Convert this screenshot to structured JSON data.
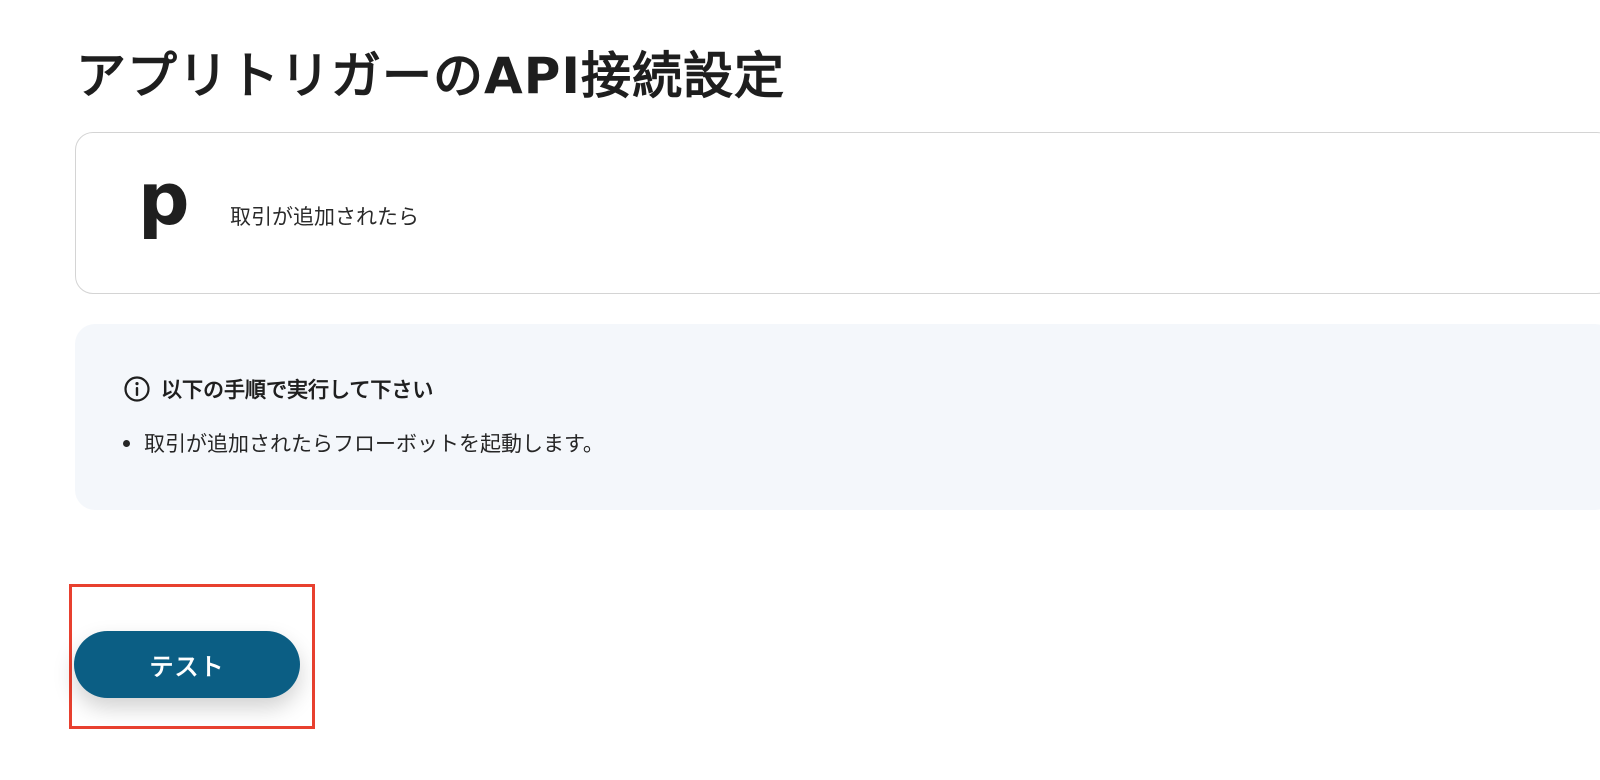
{
  "page": {
    "title": "アプリトリガーのAPI接続設定"
  },
  "trigger_card": {
    "app_logo_text": "p",
    "trigger_name": "取引が追加されたら"
  },
  "info_panel": {
    "icon": "info-icon",
    "title": "以下の手順で実行して下さい",
    "items": [
      "取引が追加されたらフローボットを起動します。"
    ]
  },
  "actions": {
    "test_label": "テスト"
  },
  "colors": {
    "primary_button": "#0b5e84",
    "info_panel_bg": "#f4f7fb",
    "highlight_border": "#e8402f",
    "card_border": "#d4d4d4"
  }
}
